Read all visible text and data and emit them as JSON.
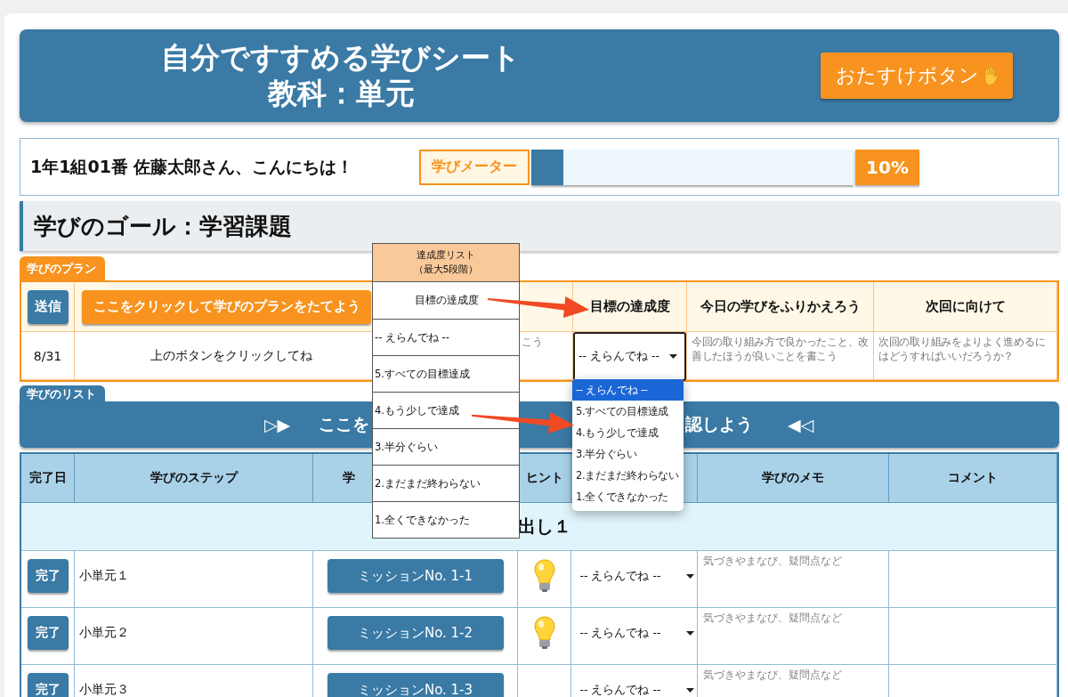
{
  "header": {
    "title": "自分ですすめる学びシート",
    "subtitle": "教科：単元",
    "help_button": "おたすけボタン"
  },
  "greeting": {
    "text": "1年1組01番 佐藤太郎さん、こんにちは！",
    "meter_label": "学びメーター",
    "level": 0.1,
    "reading": "10%"
  },
  "goal": {
    "text": "学びのゴール：学習課題"
  },
  "plan": {
    "tab": "学びのプラン",
    "send_button": "送信",
    "plan_button": "ここをクリックして学びのプランをたてよう",
    "columns": [
      "目標の達成度",
      "今日の学びをふりかえろう",
      "次回に向けて"
    ],
    "row": {
      "date": "8/31",
      "instruction": "上のボタンをクリックしてね",
      "column_3": "こう",
      "achievement": "-- えらんでね --",
      "reflection_placeholder": "今回の取り組み方で良かったこと、改善したほうが良いことを書こう",
      "next_placeholder": "次回の取り組みをよりよく進めるにはどうすればいいだろうか？"
    }
  },
  "dropdown": {
    "options": [
      {
        "label": "-- えらんでね --",
        "selected": true
      },
      {
        "label": "5.すべての目標達成",
        "selected": false
      },
      {
        "label": "4.もう少しで達成",
        "selected": false
      },
      {
        "label": "3.半分ぐらい",
        "selected": false
      },
      {
        "label": "2.まだまだ終わらない",
        "selected": false
      },
      {
        "label": "1.全くできなかった",
        "selected": false
      }
    ]
  },
  "legend": {
    "title": "達成度リスト",
    "subtitle": "（最大5段階）",
    "items": [
      "目標の達成度",
      "-- えらんでね --",
      "5.すべての目標達成",
      "4.もう少しで達成",
      "3.半分ぐらい",
      "2.まだまだ終わらない",
      "1.全くできなかった"
    ]
  },
  "list": {
    "tab": "学びのリスト",
    "banner": {
      "left_mark": "▷▶",
      "text_parts": [
        "ここを",
        "認しよう"
      ],
      "right_mark": "◀◁"
    },
    "columns": [
      {
        "kind": "label",
        "label": "完了日"
      },
      {
        "kind": "label",
        "label": "学びのステップ"
      },
      {
        "kind": "cut",
        "label": "学"
      },
      {
        "kind": "label",
        "label": "ヒント"
      },
      {
        "kind": "covered"
      },
      {
        "kind": "label",
        "label": "学びのメモ"
      },
      {
        "kind": "label",
        "label": "コメント"
      }
    ],
    "heading": "出し１",
    "rows": [
      {
        "done_button": "完了",
        "step": "小単元１",
        "mission": "ミッションNo. 1-1",
        "hint": true,
        "achievement": "-- えらんでね --",
        "memo_placeholder": "気づきやまなび、疑問点など"
      },
      {
        "done_button": "完了",
        "step": "小単元２",
        "mission": "ミッションNo. 1-2",
        "hint": true,
        "achievement": "-- えらんでね --",
        "memo_placeholder": "気づきやまなび、疑問点など"
      },
      {
        "done_button": "完了",
        "step": "小単元３",
        "mission": "ミッションNo. 1-3",
        "hint": false,
        "achievement": "-- えらんでね --",
        "memo_placeholder": "気づきやまなび、疑問点など"
      }
    ]
  }
}
